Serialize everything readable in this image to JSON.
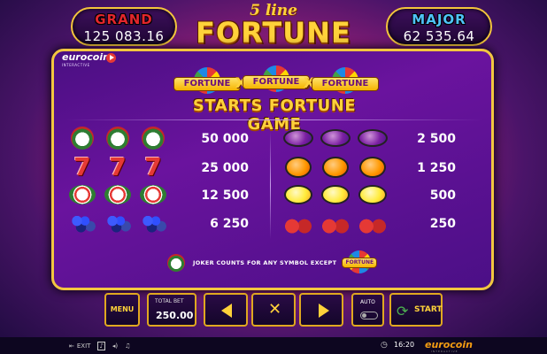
{
  "jackpots": {
    "grand": {
      "label": "GRAND",
      "value": "125 083.16"
    },
    "major": {
      "label": "MAJOR",
      "value": "62 535.64"
    }
  },
  "logo": {
    "small": "5 line",
    "big": "FORTUNE"
  },
  "brand": {
    "name": "eurocoin",
    "sub": "INTERACTIVE"
  },
  "paytable": {
    "badge_text": "FORTUNE",
    "x_sep": "X",
    "starts_text": "STARTS FORTUNE GAME",
    "left_rows": [
      {
        "symbol": "joker",
        "payout": "50 000"
      },
      {
        "symbol": "seven",
        "payout": "25 000"
      },
      {
        "symbol": "watermelon",
        "payout": "12 500"
      },
      {
        "symbol": "grapes",
        "payout": "6 250"
      }
    ],
    "right_rows": [
      {
        "symbol": "plum",
        "payout": "2 500"
      },
      {
        "symbol": "orange",
        "payout": "1 250"
      },
      {
        "symbol": "lemon",
        "payout": "500"
      },
      {
        "symbol": "cherry",
        "payout": "250"
      }
    ],
    "joker_note": "JOKER COUNTS FOR ANY SYMBOL EXCEPT"
  },
  "controls": {
    "menu": "MENU",
    "total_bet_label": "TOTAL BET",
    "total_bet_value": "250.00",
    "auto_label": "AUTO",
    "start_label": "START",
    "seven_glyph": "7"
  },
  "statusbar": {
    "exit": "EXIT",
    "time": "16:20",
    "brand": "eurocoin",
    "brand_sub": "INTERACTIVE"
  },
  "colors": {
    "gold": "#ffd23a",
    "grand": "#e3262c",
    "major": "#4fc3f7",
    "panel": "#5a1190"
  }
}
